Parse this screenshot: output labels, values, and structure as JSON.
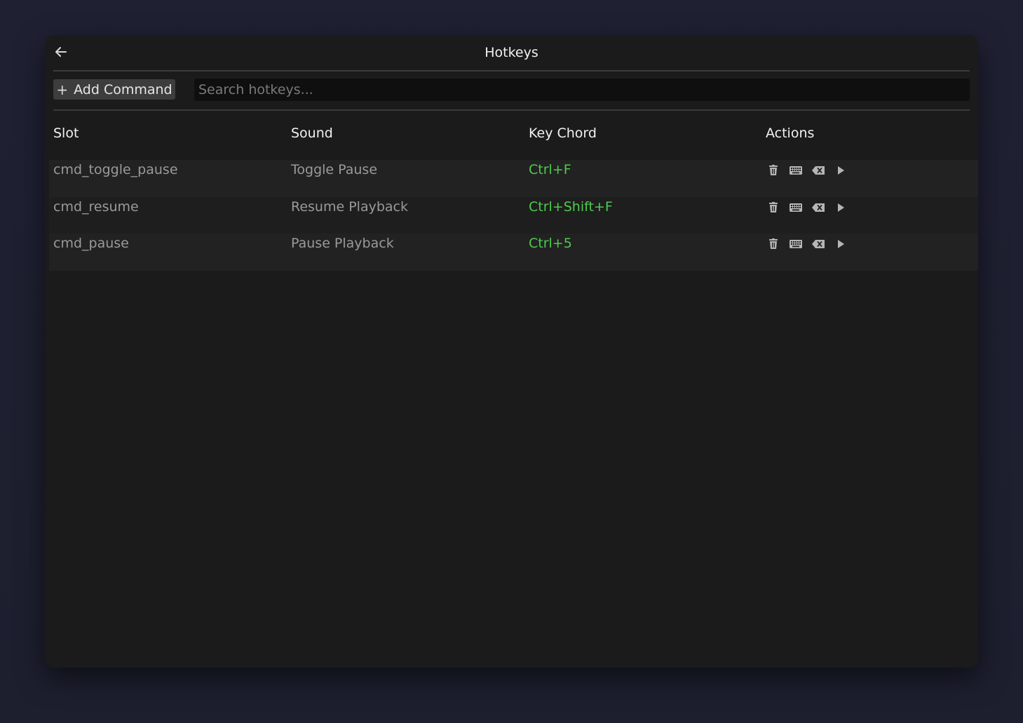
{
  "window": {
    "title": "Hotkeys",
    "back_icon": "arrow-left-icon"
  },
  "toolbar": {
    "add_icon": "plus-icon",
    "add_label": "Add Command",
    "search_placeholder": "Search hotkeys..."
  },
  "table": {
    "headers": {
      "slot": "Slot",
      "sound": "Sound",
      "chord": "Key Chord",
      "actions": "Actions"
    },
    "rows": [
      {
        "slot": "cmd_toggle_pause",
        "sound": "Toggle Pause",
        "chord": "Ctrl+F"
      },
      {
        "slot": "cmd_resume",
        "sound": "Resume Playback",
        "chord": "Ctrl+Shift+F"
      },
      {
        "slot": "cmd_pause",
        "sound": "Pause Playback",
        "chord": "Ctrl+5"
      }
    ],
    "row_actions": [
      "trash-icon",
      "keyboard-icon",
      "backspace-clear-icon",
      "play-icon"
    ]
  },
  "colors": {
    "background": "#1e2030",
    "panel": "#1b1b1b",
    "chord_text": "#4ecb4e",
    "muted_text": "#9a9a9a",
    "header_text": "#f2f2f2"
  }
}
